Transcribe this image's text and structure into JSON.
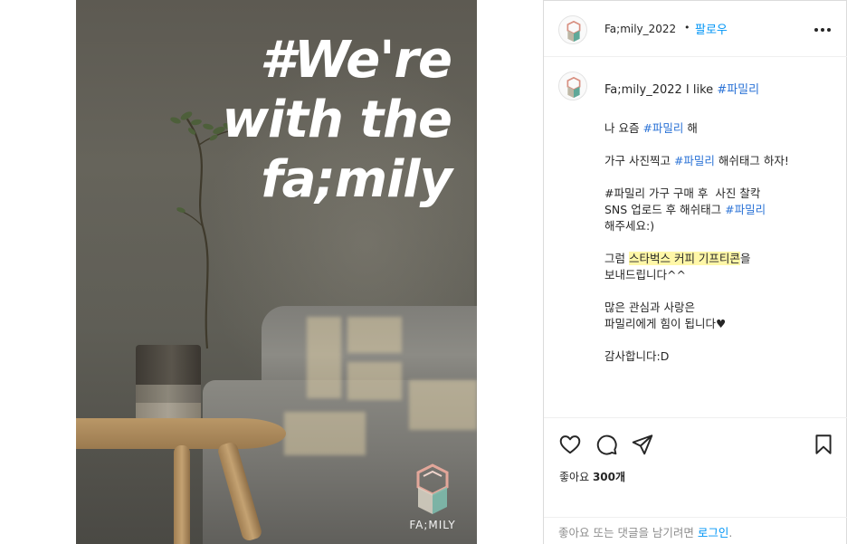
{
  "image": {
    "headline_lines": [
      "#We're",
      "with the",
      "fa;mily"
    ],
    "brand_name": "FA;MILY"
  },
  "post": {
    "username": "Fa;mily_2022",
    "follow_label": "팔로우",
    "separator": "•",
    "caption": {
      "username": "Fa;mily_2022",
      "intro_text": " I like ",
      "intro_hashtag": "#파밀리",
      "lines": {
        "p1_a": "나 요즘 ",
        "p1_tag": "#파밀리",
        "p1_b": " 해",
        "p2_a": "가구 사진찍고 ",
        "p2_tag": "#파밀리",
        "p2_b": " 해쉬태그 하자!",
        "p3_l1": "#파밀리 가구 구매 후  사진 찰칵",
        "p3_l2_a": "SNS 업로드 후 해쉬태그 ",
        "p3_l2_tag": "#파밀리",
        "p3_l3": "해주세요:)",
        "p4_a": "그럼 ",
        "p4_highlight": "스타벅스 커피 기프티콘",
        "p4_b": "을",
        "p4_l2": "보내드립니다^^",
        "p5_l1": "많은 관심과 사랑은",
        "p5_l2": "파밀리에게 힘이 됩니다♥",
        "p6": "감사합니다:D"
      }
    },
    "likes_label": "좋아요 ",
    "likes_count": "300개",
    "comment_prompt": "좋아요 또는 댓글을 남기려면 ",
    "login_link": "로그인",
    "comment_end": "."
  },
  "colors": {
    "link_blue": "#0095f6",
    "hashtag_blue": "#2a72d6",
    "highlight": "#fff7a8"
  },
  "icons": [
    "plant-icon",
    "brand-logo-icon",
    "more-options-icon",
    "heart-icon",
    "comment-icon",
    "share-icon",
    "bookmark-icon"
  ]
}
